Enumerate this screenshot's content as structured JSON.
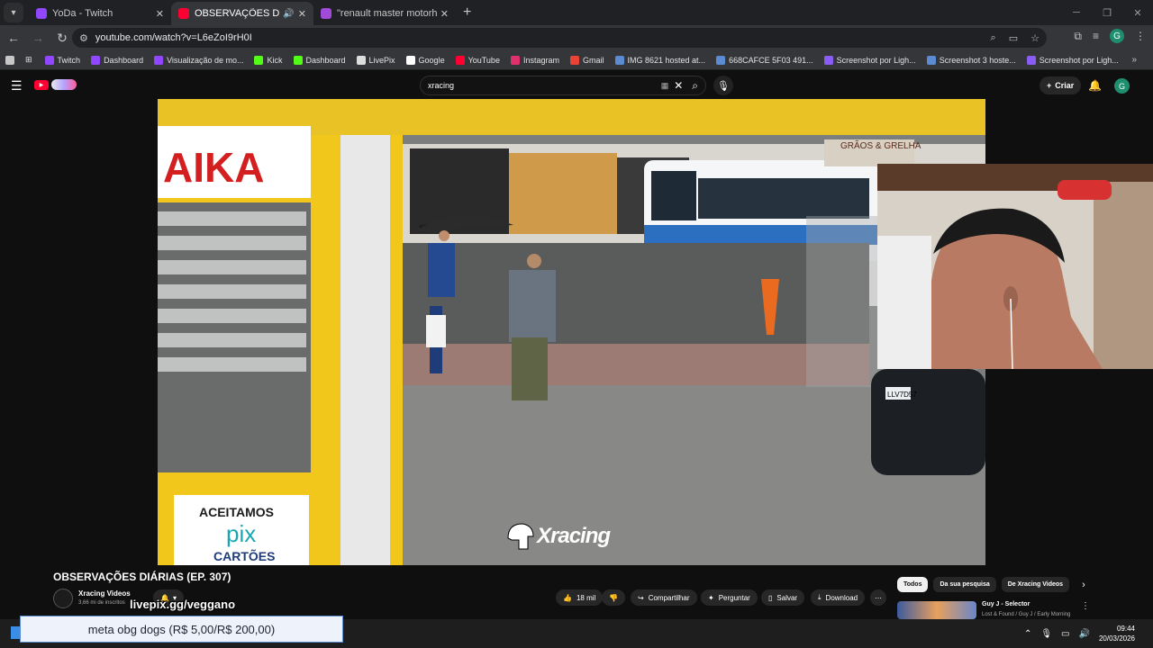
{
  "browser": {
    "tabs": [
      {
        "title": "YoDa - Twitch",
        "color": "#9146ff",
        "active": false
      },
      {
        "title": "OBSERVAÇÕES DIÁRIAS (EP",
        "color": "#ff0033",
        "active": true
      },
      {
        "title": "\"renault master motorhome\" -",
        "color": "#a24bd8",
        "active": false
      }
    ],
    "url": "youtube.com/watch?v=L6eZoI9rH0I",
    "bookmarks": [
      {
        "label": "Twitch",
        "color": "#9146ff"
      },
      {
        "label": "Dashboard",
        "color": "#9146ff"
      },
      {
        "label": "Visualização de mo...",
        "color": "#9146ff"
      },
      {
        "label": "Kick",
        "color": "#53fc18"
      },
      {
        "label": "Dashboard",
        "color": "#53fc18"
      },
      {
        "label": "LivePix",
        "color": "#dddddd"
      },
      {
        "label": "Google",
        "color": "#ffffff"
      },
      {
        "label": "YouTube",
        "color": "#ff0033"
      },
      {
        "label": "Instagram",
        "color": "#e1306c"
      },
      {
        "label": "Gmail",
        "color": "#ea4335"
      },
      {
        "label": "IMG 8621 hosted at...",
        "color": "#5b8bd1"
      },
      {
        "label": "668CAFCE 5F03 491...",
        "color": "#5b8bd1"
      },
      {
        "label": "Screenshot por Ligh...",
        "color": "#8a5cf6"
      },
      {
        "label": "Screenshot 3 hoste...",
        "color": "#5b8bd1"
      },
      {
        "label": "Screenshot por Ligh...",
        "color": "#8a5cf6"
      }
    ]
  },
  "youtube": {
    "search_value": "xracing",
    "create_label": "Criar",
    "avatar_letter": "G",
    "watermark": "Xracing",
    "video_title": "OBSERVAÇÕES DIÁRIAS (EP. 307)",
    "channel_name": "Xracing Videos",
    "channel_subs": "3,66 mi de inscritos",
    "overlay_text": "livepix.gg/veggano",
    "actions": {
      "likes": "18 mil",
      "share": "Compartilhar",
      "ask": "Perguntar",
      "save": "Salvar",
      "download": "Download"
    },
    "chips": [
      "Todos",
      "Da sua pesquisa",
      "De Xracing Videos"
    ],
    "recommendation": {
      "title": "Guy J - Selector",
      "subtitle": "Lost & Found / Guy J / Early Morning"
    }
  },
  "scene": {
    "sign_top": "AIKA",
    "shop_sign": "GRÃOS & GRELHA",
    "plate": "LLV7D57",
    "sign_accept": "ACEITAMOS",
    "sign_pix": "pix",
    "sign_cards": "CARTÕES"
  },
  "stream_alert": "meta obg dogs (R$ 5,00/R$ 200,00)",
  "taskbar": {
    "time": "09:44",
    "date": "20/03/2026"
  }
}
